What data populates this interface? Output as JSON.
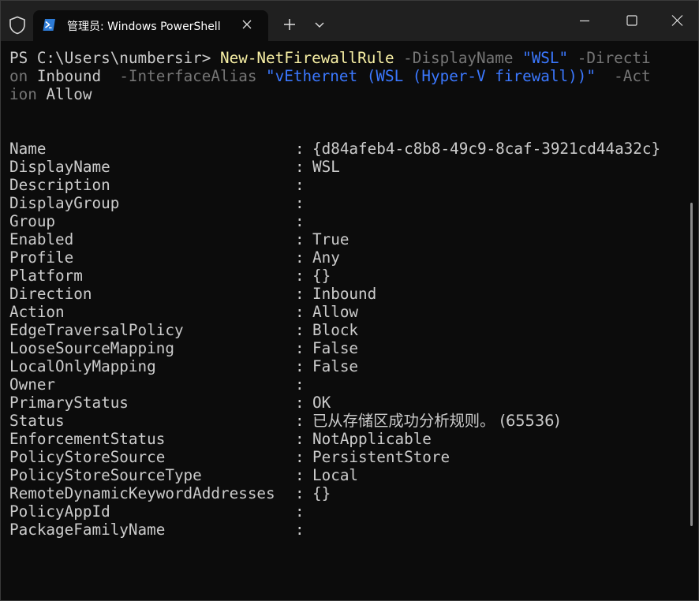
{
  "window": {
    "tab_title": "管理员: Windows PowerShell",
    "new_tab_glyph": "+",
    "icons": {
      "shield": "shield-icon",
      "powershell": "powershell-icon",
      "close_tab": "close-icon",
      "new_tab": "plus-icon",
      "dropdown": "chevron-down-icon",
      "minimize": "minimize-icon",
      "maximize": "maximize-icon",
      "close_window": "close-icon"
    }
  },
  "command": {
    "prompt": "PS C:\\Users\\numbersir> ",
    "cmdlet": "New-NetFirewallRule",
    "line1": {
      "sp1": " ",
      "p1": "-DisplayName",
      "sp2": " ",
      "v1": "\"WSL\"",
      "sp3": " ",
      "p2_part1": "-Directi"
    },
    "line2": {
      "p2_part2": "on",
      "sp1": " ",
      "v2": "Inbound",
      "sp2": "  ",
      "p3": "-InterfaceAlias",
      "sp3": " ",
      "v3": "\"vEthernet (WSL (Hyper-V firewall))\"",
      "sp4": "  ",
      "p4_part1": "-Act"
    },
    "line3": {
      "p4_part2": "ion",
      "sp1": " ",
      "v4": "Allow"
    }
  },
  "output": {
    "colon": ":",
    "rows": [
      {
        "name": "Name",
        "value": "{d84afeb4-c8b8-49c9-8caf-3921cd44a32c}"
      },
      {
        "name": "DisplayName",
        "value": "WSL"
      },
      {
        "name": "Description",
        "value": ""
      },
      {
        "name": "DisplayGroup",
        "value": ""
      },
      {
        "name": "Group",
        "value": ""
      },
      {
        "name": "Enabled",
        "value": "True"
      },
      {
        "name": "Profile",
        "value": "Any"
      },
      {
        "name": "Platform",
        "value": "{}"
      },
      {
        "name": "Direction",
        "value": "Inbound"
      },
      {
        "name": "Action",
        "value": "Allow"
      },
      {
        "name": "EdgeTraversalPolicy",
        "value": "Block"
      },
      {
        "name": "LooseSourceMapping",
        "value": "False"
      },
      {
        "name": "LocalOnlyMapping",
        "value": "False"
      },
      {
        "name": "Owner",
        "value": ""
      },
      {
        "name": "PrimaryStatus",
        "value": "OK"
      },
      {
        "name": "Status",
        "value": "已从存储区成功分析规则。 (65536)"
      },
      {
        "name": "EnforcementStatus",
        "value": "NotApplicable"
      },
      {
        "name": "PolicyStoreSource",
        "value": "PersistentStore"
      },
      {
        "name": "PolicyStoreSourceType",
        "value": "Local"
      },
      {
        "name": "RemoteDynamicKeywordAddresses",
        "value": "{}"
      },
      {
        "name": "PolicyAppId",
        "value": ""
      },
      {
        "name": "PackageFamilyName",
        "value": ""
      }
    ]
  },
  "colors": {
    "background": "#0c0c0c",
    "titlebar": "#202020",
    "text": "#cccccc",
    "cmdlet": "#f9f1a5",
    "parameter": "#767676",
    "string": "#3b78ff"
  }
}
